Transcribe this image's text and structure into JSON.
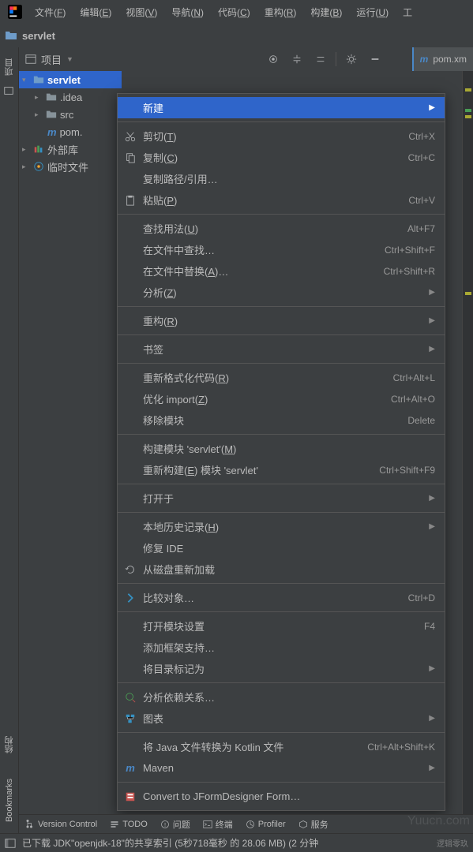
{
  "menubar": {
    "items": [
      {
        "label": "文件",
        "key": "F"
      },
      {
        "label": "编辑",
        "key": "E"
      },
      {
        "label": "视图",
        "key": "V"
      },
      {
        "label": "导航",
        "key": "N"
      },
      {
        "label": "代码",
        "key": "C"
      },
      {
        "label": "重构",
        "key": "R"
      },
      {
        "label": "构建",
        "key": "B"
      },
      {
        "label": "运行",
        "key": "U"
      },
      {
        "label": "工",
        "key": ""
      }
    ]
  },
  "breadcrumb": {
    "project": "servlet"
  },
  "project_panel": {
    "label": "项目"
  },
  "editor_tab": {
    "label": "pom.xm"
  },
  "tree": {
    "root": "servlet",
    "items": [
      {
        "label": ".idea",
        "type": "folder"
      },
      {
        "label": "src",
        "type": "folder"
      },
      {
        "label": "pom.",
        "type": "maven"
      }
    ],
    "external": "外部库",
    "scratch": "临时文件"
  },
  "context_menu": {
    "groups": [
      [
        {
          "label": "新建",
          "submenu": true,
          "hover": true
        }
      ],
      [
        {
          "icon": "cut",
          "label": "剪切(<u>T</u>)",
          "shortcut": "Ctrl+X"
        },
        {
          "icon": "copy",
          "label": "复制(<u>C</u>)",
          "shortcut": "Ctrl+C"
        },
        {
          "label": "复制路径/引用…"
        },
        {
          "icon": "paste",
          "label": "粘贴(<u>P</u>)",
          "shortcut": "Ctrl+V"
        }
      ],
      [
        {
          "label": "查找用法(<u>U</u>)",
          "shortcut": "Alt+F7"
        },
        {
          "label": "在文件中查找…",
          "shortcut": "Ctrl+Shift+F"
        },
        {
          "label": "在文件中替换(<u>A</u>)…",
          "shortcut": "Ctrl+Shift+R"
        },
        {
          "label": "分析(<u>Z</u>)",
          "submenu": true
        }
      ],
      [
        {
          "label": "重构(<u>R</u>)",
          "submenu": true
        }
      ],
      [
        {
          "label": "书签",
          "submenu": true
        }
      ],
      [
        {
          "label": "重新格式化代码(<u>R</u>)",
          "shortcut": "Ctrl+Alt+L"
        },
        {
          "label": "优化 import(<u>Z</u>)",
          "shortcut": "Ctrl+Alt+O"
        },
        {
          "label": "移除模块",
          "shortcut": "Delete"
        }
      ],
      [
        {
          "label": "构建模块 'servlet'(<u>M</u>)"
        },
        {
          "label": "重新构建(<u>E</u>) 模块 'servlet'",
          "shortcut": "Ctrl+Shift+F9"
        }
      ],
      [
        {
          "label": "打开于",
          "submenu": true
        }
      ],
      [
        {
          "label": "本地历史记录(<u>H</u>)",
          "submenu": true
        },
        {
          "label": "修复 IDE"
        },
        {
          "icon": "reload",
          "label": "从磁盘重新加载"
        }
      ],
      [
        {
          "icon": "diff",
          "label": "比较对象…",
          "shortcut": "Ctrl+D"
        }
      ],
      [
        {
          "label": "打开模块设置",
          "shortcut": "F4"
        },
        {
          "label": "添加框架支持…"
        },
        {
          "label": "将目录标记为",
          "submenu": true
        }
      ],
      [
        {
          "icon": "analyze",
          "label": "分析依赖关系…"
        },
        {
          "icon": "diagram",
          "label": "图表",
          "submenu": true
        }
      ],
      [
        {
          "label": "将 Java 文件转换为 Kotlin 文件",
          "shortcut": "Ctrl+Alt+Shift+K"
        },
        {
          "icon": "maven",
          "label": "Maven",
          "submenu": true
        }
      ],
      [
        {
          "icon": "form",
          "label": "Convert to JFormDesigner Form…"
        }
      ]
    ]
  },
  "left_gutter": {
    "top": "项目",
    "mid": "结构",
    "bot": "Bookmarks"
  },
  "bottom_bar": {
    "items": [
      {
        "icon": "vcs",
        "label": "Version Control"
      },
      {
        "icon": "todo",
        "label": "TODO"
      },
      {
        "icon": "problems",
        "label": "问题"
      },
      {
        "icon": "terminal",
        "label": "终端"
      },
      {
        "icon": "profiler",
        "label": "Profiler"
      },
      {
        "icon": "services",
        "label": "服务"
      }
    ]
  },
  "status_bar": {
    "text": "已下载 JDK\"openjdk-18\"的共享索引 (5秒718毫秒 的 28.06 MB) (2 分钟",
    "tail": "逻辑零玖"
  },
  "watermark": "Yuucn.com"
}
